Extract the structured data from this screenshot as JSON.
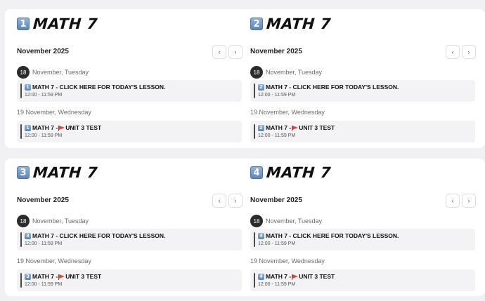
{
  "calendars": [
    {
      "badge": "1",
      "title": "MATH 7",
      "month": "November 2025",
      "day1": {
        "num": "18",
        "label": "November, Tuesday"
      },
      "event1": {
        "title": "MATH 7 - CLICK HERE FOR TODAY'S LESSON.",
        "time": "12:00 - 11:59 PM"
      },
      "day2": {
        "label": "19 November, Wednesday"
      },
      "event2": {
        "title_prefix": "MATH 7 -",
        "title_suffix": "UNIT 3 TEST",
        "time": "12:00 - 11:59 PM"
      }
    },
    {
      "badge": "2",
      "title": "MATH 7",
      "month": "November 2025",
      "day1": {
        "num": "18",
        "label": "November, Tuesday"
      },
      "event1": {
        "title": "MATH 7 - CLICK HERE FOR TODAY'S LESSON.",
        "time": "12:00 - 11:59 PM"
      },
      "day2": {
        "label": "19 November, Wednesday"
      },
      "event2": {
        "title_prefix": "MATH 7 -",
        "title_suffix": "UNIT 3 TEST",
        "time": "12:00 - 11:59 PM"
      }
    },
    {
      "badge": "3",
      "title": "MATH 7",
      "month": "November 2025",
      "day1": {
        "num": "18",
        "label": "November, Tuesday"
      },
      "event1": {
        "title": "MATH 7 - CLICK HERE FOR TODAY'S LESSON.",
        "time": "12:00 - 11:59 PM"
      },
      "day2": {
        "label": "19 November, Wednesday"
      },
      "event2": {
        "title_prefix": "MATH 7 -",
        "title_suffix": "UNIT 3 TEST",
        "time": "12:00 - 11:59 PM"
      }
    },
    {
      "badge": "4",
      "title": "MATH 7",
      "month": "November 2025",
      "day1": {
        "num": "18",
        "label": "November, Tuesday"
      },
      "event1": {
        "title": "MATH 7 - CLICK HERE FOR TODAY'S LESSON.",
        "time": "12:00 - 11:59 PM"
      },
      "day2": {
        "label": "19 November, Wednesday"
      },
      "event2": {
        "title_prefix": "MATH 7 -",
        "title_suffix": "UNIT 3 TEST",
        "time": "12:00 - 11:59 PM"
      }
    }
  ],
  "nav": {
    "prev": "‹",
    "next": "›"
  },
  "icons": {
    "badge": "keycap-number-icon",
    "flag": "red-flag-icon"
  },
  "colors": {
    "event_bg": "#f3f3f5",
    "day_circle": "#2b2b2b",
    "flag": "#d9493a",
    "badge": "#6f95c6"
  }
}
